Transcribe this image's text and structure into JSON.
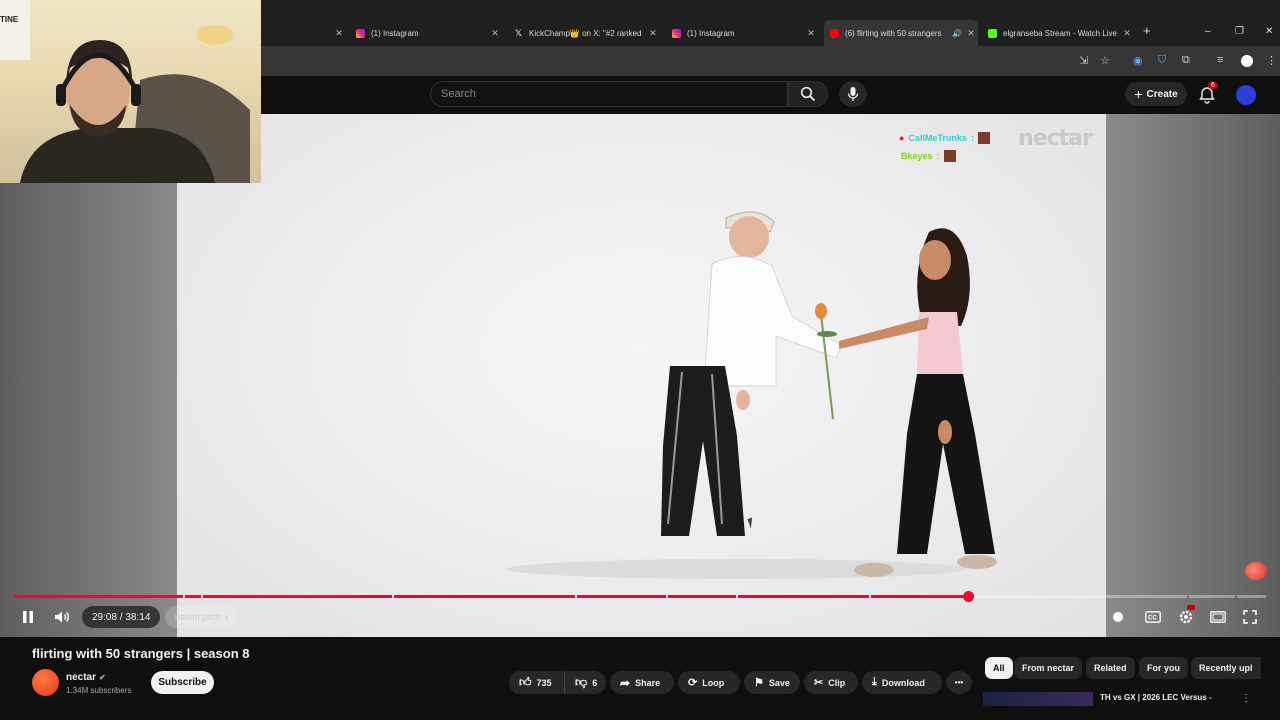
{
  "browser": {
    "tabs": [
      {
        "title": "",
        "favicon": "blank-icon",
        "color": "#1f1f1f"
      },
      {
        "title": "(1) Instagram",
        "favicon": "instagram-icon",
        "color": "#e1306c"
      },
      {
        "title": "KickChamp👑 on X: \"#2 ranked",
        "favicon": "x-icon",
        "color": "#ffffff"
      },
      {
        "title": "(1) Instagram",
        "favicon": "instagram-icon",
        "color": "#e1306c"
      },
      {
        "title": "(6) flirting with 50 strangers",
        "favicon": "youtube-icon",
        "color": "#ff0000",
        "active": true
      },
      {
        "title": "elgranseba Stream - Watch Live",
        "favicon": "kick-icon",
        "color": "#53fc18"
      }
    ],
    "new_tab": "+",
    "window_controls": [
      "–",
      "❐",
      "✕"
    ]
  },
  "youtube": {
    "search_placeholder": "Search",
    "create_label": "Create",
    "notifications_count": "6"
  },
  "video": {
    "brand_watermark": "nectar",
    "chat": [
      {
        "user": "CallMeTrunks",
        "separator": ":",
        "color": "#2ed1d1"
      },
      {
        "user": "Bkeyes",
        "separator": ":",
        "color": "#7fd321"
      }
    ],
    "time": "29:08 / 38:14",
    "chapter": "naomi pitch",
    "progress_fraction": 0.762
  },
  "info": {
    "title": "flirting with 50 strangers | season 8",
    "channel": "nectar",
    "subscribers": "1.34M subscribers",
    "subscribe_label": "Subscribe",
    "likes": "735",
    "dislikes": "6",
    "share": "Share",
    "loop": "Loop",
    "save": "Save",
    "clip": "Clip",
    "download": "Download",
    "more": "•••"
  },
  "chips": [
    "All",
    "From nectar",
    "Related",
    "For you",
    "Recently upl"
  ],
  "recommended": {
    "title": "TH vs GX | 2026 LEC Versus -",
    "menu": "⋮"
  },
  "colors": {
    "accent": "#ff0033",
    "bg": "#0f0f0f"
  }
}
